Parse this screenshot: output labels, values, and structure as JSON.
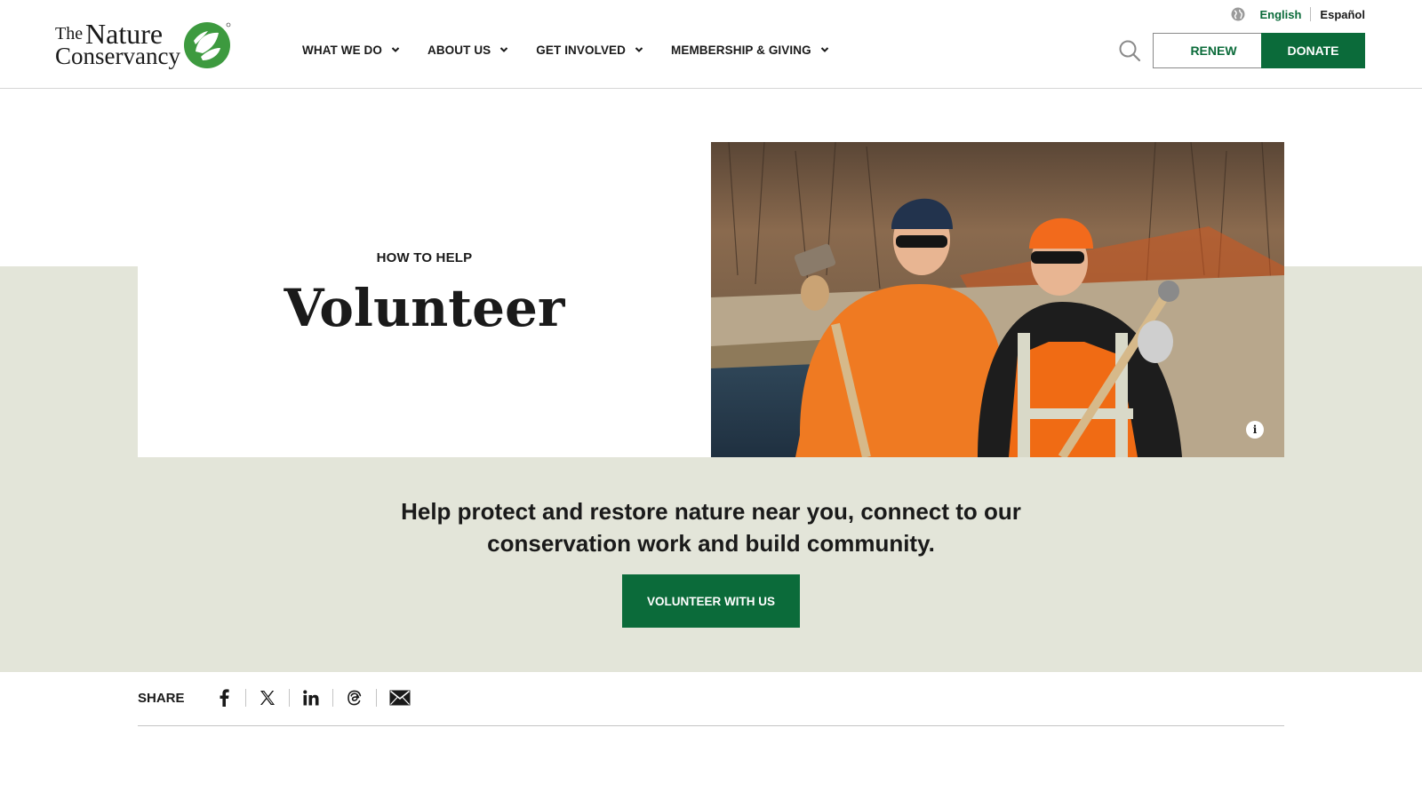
{
  "header": {
    "logo": {
      "line1_small": "The",
      "line1_big": "Nature",
      "line2": "Conservancy",
      "mark_icon": "tnc-leaf-globe-icon"
    },
    "nav": [
      {
        "label": "WHAT WE DO"
      },
      {
        "label": "ABOUT US"
      },
      {
        "label": "GET INVOLVED"
      },
      {
        "label": "MEMBERSHIP & GIVING"
      }
    ],
    "language": {
      "icon": "globe-icon",
      "active": "English",
      "other": "Español"
    },
    "search_icon": "search-icon",
    "renew_label": "RENEW",
    "donate_label": "DONATE"
  },
  "hero": {
    "eyebrow": "HOW TO HELP",
    "title": "Volunteer",
    "info_label": "i",
    "description": "Help protect and restore nature near you, connect to our conservation work and build community.",
    "cta_label": "VOLUNTEER WITH US"
  },
  "share": {
    "label": "SHARE",
    "icons": [
      "facebook-icon",
      "x-icon",
      "linkedin-icon",
      "threads-icon",
      "email-icon"
    ]
  },
  "colors": {
    "brand_green": "#0b6b3a",
    "band": "#e3e5d9",
    "text": "#1a1a1a"
  }
}
